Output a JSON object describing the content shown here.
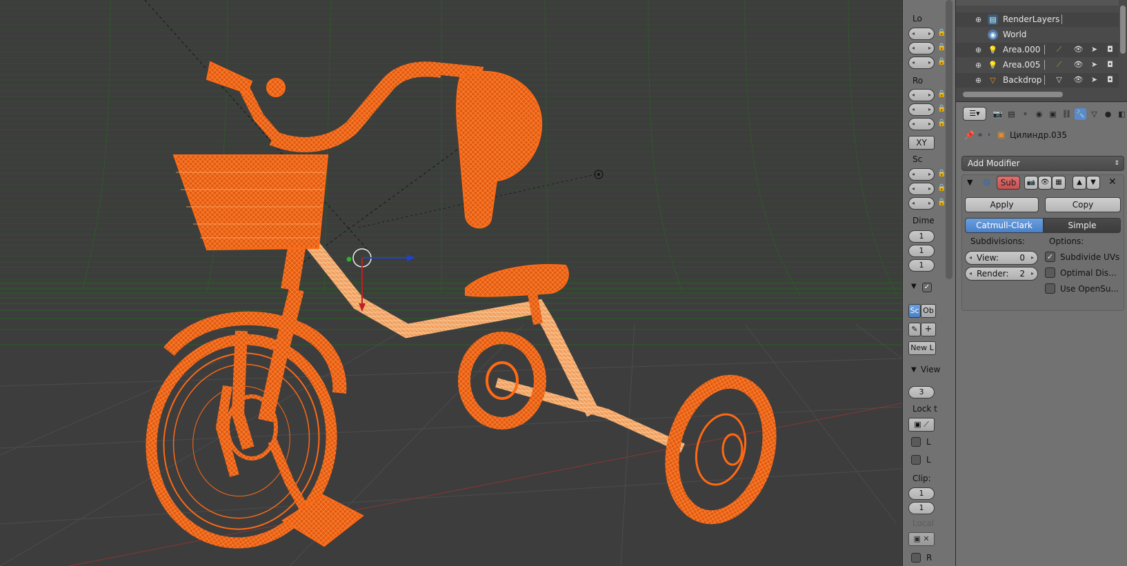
{
  "npanel": {
    "location_label": "Lo",
    "rotation_label": "Ro",
    "rotation_mode": "XY",
    "scale_label": "Sc",
    "dimensions_label": "Dime",
    "dims": [
      "1",
      "1",
      "1"
    ],
    "grease_scene": "Sc",
    "grease_object": "Ob",
    "new_layer": "New L",
    "view_header": "View",
    "lens": "3",
    "lock_label": "Lock t",
    "lock_cb1": "L",
    "lock_cb2": "L",
    "clip_label": "Clip:",
    "clip_start": "1",
    "clip_end": "1",
    "local_label": "Local",
    "render_cb": "R"
  },
  "outliner": {
    "items": [
      {
        "name": "RenderLayers",
        "icon": "renderlayers-icon"
      },
      {
        "name": "World",
        "icon": "world-icon"
      },
      {
        "name": "Area.000",
        "icon": "lamp-icon"
      },
      {
        "name": "Area.005",
        "icon": "lamp-icon"
      },
      {
        "name": "Backdrop",
        "icon": "mesh-icon"
      }
    ]
  },
  "properties": {
    "object_name": "Цилиндр.035",
    "add_modifier": "Add Modifier",
    "modifier_name": "Sub",
    "apply": "Apply",
    "copy": "Copy",
    "catmull": "Catmull-Clark",
    "simple": "Simple",
    "subdivisions_label": "Subdivisions:",
    "options_label": "Options:",
    "view_label": "View:",
    "view_value": "0",
    "render_label": "Render:",
    "render_value": "2",
    "opt_subdivide_uvs": "Subdivide UVs",
    "opt_optimal": "Optimal Dis...",
    "opt_opensubdiv": "Use OpenSu..."
  },
  "colors": {
    "wire": "#ff6a14",
    "wire_selected": "#ffb070",
    "viewport_bg": "#3d3d3d",
    "grid": "#2f6a2a",
    "accent": "#5a8ad0"
  }
}
